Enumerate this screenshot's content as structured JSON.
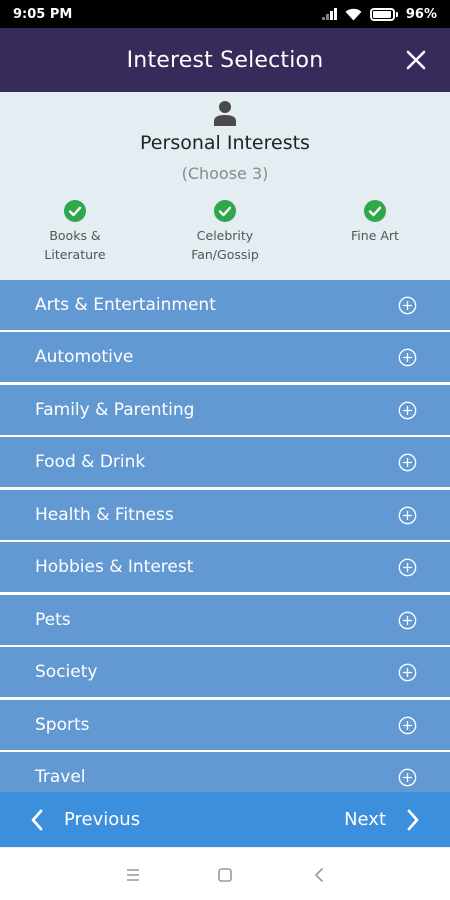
{
  "status_bar": {
    "time": "9:05 PM",
    "battery_percent": "96%",
    "battery_level": 0.96,
    "icons": [
      "signal-icon",
      "wifi-icon",
      "battery-icon"
    ]
  },
  "header": {
    "title": "Interest Selection",
    "close_icon": "close-icon"
  },
  "summary": {
    "icon": "person-icon",
    "title": "Personal Interests",
    "subtitle": "(Choose 3)",
    "selected": [
      {
        "line1": "Books &",
        "line2": "Literature",
        "icon": "check-circle-icon"
      },
      {
        "line1": "Celebrity",
        "line2": "Fan/Gossip",
        "icon": "check-circle-icon"
      },
      {
        "line1": "Fine Art",
        "line2": "",
        "icon": "check-circle-icon"
      }
    ]
  },
  "categories": [
    {
      "label": "Arts & Entertainment"
    },
    {
      "label": "Automotive"
    },
    {
      "label": "Family & Parenting"
    },
    {
      "label": "Food & Drink"
    },
    {
      "label": "Health & Fitness"
    },
    {
      "label": "Hobbies & Interest"
    },
    {
      "label": "Pets"
    },
    {
      "label": "Society"
    },
    {
      "label": "Sports"
    },
    {
      "label": "Travel"
    }
  ],
  "footer": {
    "previous_label": "Previous",
    "next_label": "Next"
  },
  "system_nav": {
    "icons": [
      "menu-icon",
      "home-icon",
      "back-icon"
    ]
  },
  "colors": {
    "header_bg": "#362b5a",
    "summary_bg": "#e3edf2",
    "category_bg": "#6399d3",
    "nav_bg": "#3b8fdc",
    "check_green": "#2ea84a"
  }
}
